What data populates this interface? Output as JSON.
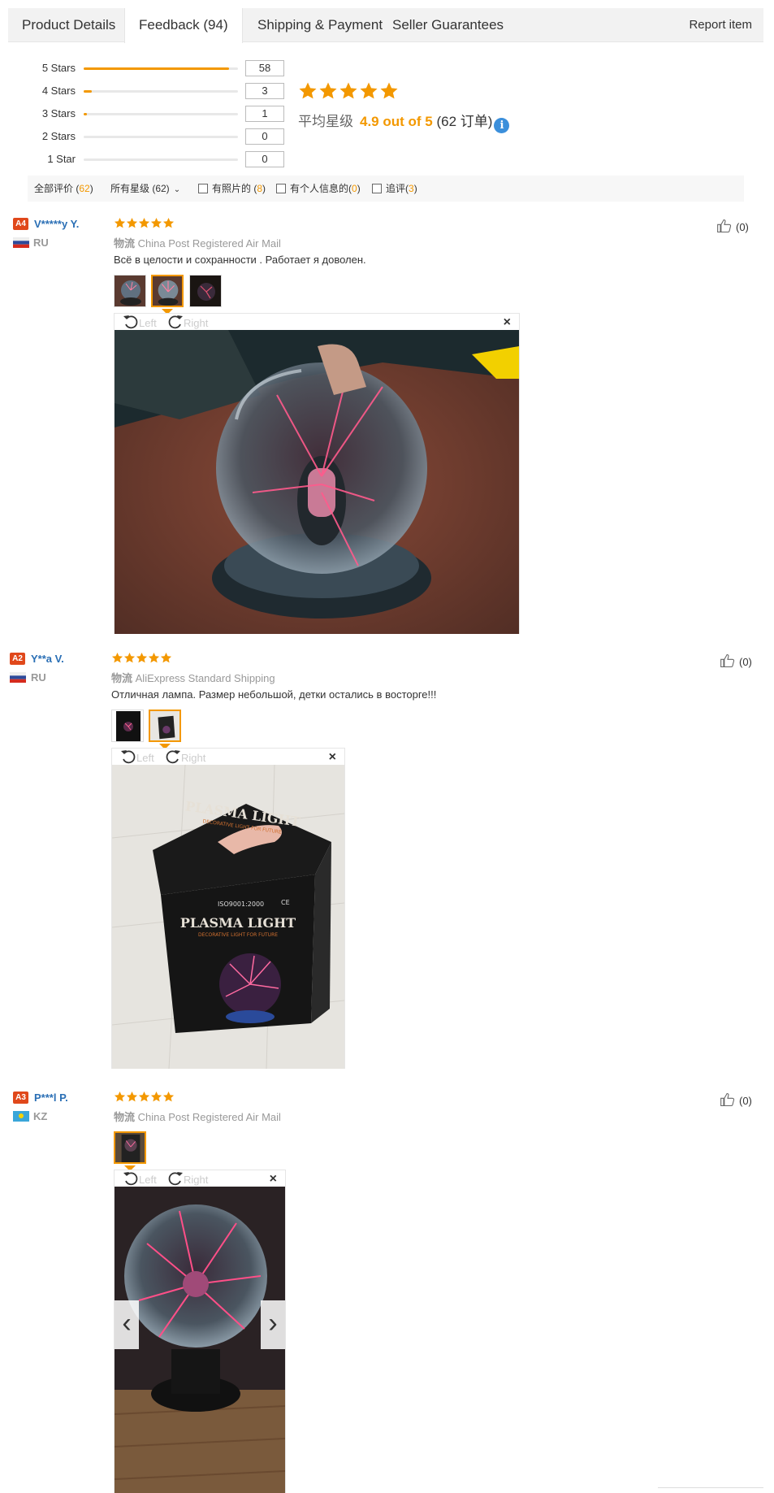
{
  "tabs": [
    {
      "label": "Product Details"
    },
    {
      "label": "Feedback (94)"
    },
    {
      "label": "Shipping & Payment"
    },
    {
      "label": "Seller Guarantees"
    }
  ],
  "report_label": "Report item",
  "histogram": [
    {
      "label": "5 Stars",
      "count": "58",
      "fraction": 0.94
    },
    {
      "label": "4 Stars",
      "count": "3",
      "fraction": 0.05
    },
    {
      "label": "3 Stars",
      "count": "1",
      "fraction": 0.02
    },
    {
      "label": "2 Stars",
      "count": "0",
      "fraction": 0
    },
    {
      "label": "1 Star",
      "count": "0",
      "fraction": 0
    }
  ],
  "summary": {
    "stars": 5,
    "label": "平均星级",
    "score": "4.9 out of 5",
    "orders": "(62 订单)",
    "info_glyph": "i"
  },
  "filters": {
    "all_label": "全部评价 (",
    "all_count": "62",
    "all_close": ")",
    "stars_label": "所有星级 (62)",
    "stars_caret": "⌄",
    "photos_label": "有照片的 (",
    "photos_count": "8",
    "photos_close": ")",
    "personal_label": "有个人信息的(",
    "personal_count": "0",
    "personal_close": ")",
    "followup_label": "追评(",
    "followup_count": "3",
    "followup_close": ")"
  },
  "viewer_labels": {
    "left": "Left",
    "right": "Right",
    "close": "×"
  },
  "logistics_label": "物流",
  "reviews": [
    {
      "level": "A4",
      "name": "V*****y Y.",
      "country": "RU",
      "stars": 5,
      "logistics": "China Post Registered Air Mail",
      "text": "Всё в целости и сохранности . Работает я доволен.",
      "useful": "(0)",
      "thumb_count": 3,
      "active_thumb": 1
    },
    {
      "level": "A2",
      "name": "Y**a V.",
      "country": "RU",
      "stars": 5,
      "logistics": "AliExpress Standard Shipping",
      "text": "Отличная лампа. Размер небольшой, детки остались в восторге!!!",
      "useful": "(0)",
      "thumb_count": 2,
      "active_thumb": 1
    },
    {
      "level": "A3",
      "name": "P***l P.",
      "country": "KZ",
      "stars": 5,
      "logistics": "China Post Registered Air Mail",
      "text": "",
      "useful": "(0)",
      "thumb_count": 1,
      "active_thumb": 0,
      "prev_glyph": "‹",
      "next_glyph": "›"
    }
  ],
  "box_print": {
    "title_top": "PLASMA LIGHT",
    "subtitle_top": "DECORATIVE LIGHT FOR FUTURE",
    "iso": "ISO9001:2000",
    "ce": "CE",
    "title_front": "PLASMA LIGHT",
    "subtitle_front": "DECORATIVE LIGHT FOR FUTURE"
  },
  "colors": {
    "accent": "#f39800",
    "link": "#2a6fb5",
    "badge": "#e0481b",
    "info": "#3b8fdb"
  }
}
